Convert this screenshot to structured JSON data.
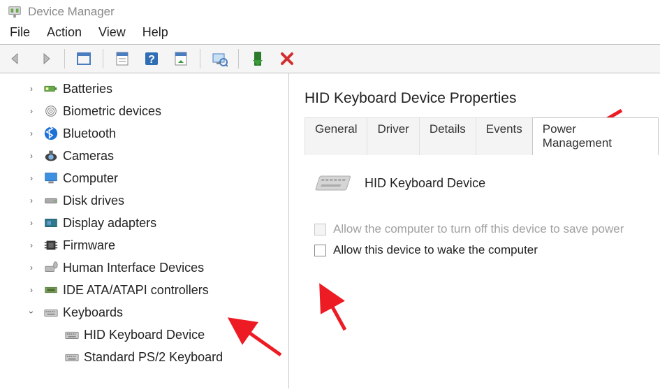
{
  "window": {
    "title": "Device Manager"
  },
  "menu": {
    "file": "File",
    "action": "Action",
    "view": "View",
    "help": "Help"
  },
  "tree": {
    "items": [
      {
        "label": "Batteries",
        "icon": "battery",
        "expanded": false
      },
      {
        "label": "Biometric devices",
        "icon": "fingerprint",
        "expanded": false
      },
      {
        "label": "Bluetooth",
        "icon": "bluetooth",
        "expanded": false
      },
      {
        "label": "Cameras",
        "icon": "camera",
        "expanded": false
      },
      {
        "label": "Computer",
        "icon": "monitor",
        "expanded": false
      },
      {
        "label": "Disk drives",
        "icon": "drive",
        "expanded": false
      },
      {
        "label": "Display adapters",
        "icon": "gpu",
        "expanded": false
      },
      {
        "label": "Firmware",
        "icon": "chip",
        "expanded": false
      },
      {
        "label": "Human Interface Devices",
        "icon": "hid",
        "expanded": false
      },
      {
        "label": "IDE ATA/ATAPI controllers",
        "icon": "ide",
        "expanded": false
      },
      {
        "label": "Keyboards",
        "icon": "keyboard",
        "expanded": true,
        "children": [
          {
            "label": "HID Keyboard Device",
            "icon": "keyboard"
          },
          {
            "label": "Standard PS/2 Keyboard",
            "icon": "keyboard"
          }
        ]
      }
    ]
  },
  "properties": {
    "title": "HID Keyboard Device Properties",
    "tabs": {
      "general": "General",
      "driver": "Driver",
      "details": "Details",
      "events": "Events",
      "power": "Power Management"
    },
    "active_tab": "power",
    "device_name": "HID Keyboard Device",
    "checkbox1_label": "Allow the computer to turn off this device to save power",
    "checkbox1_enabled": false,
    "checkbox1_checked": false,
    "checkbox2_label": "Allow this device to wake the computer",
    "checkbox2_enabled": true,
    "checkbox2_checked": false
  }
}
